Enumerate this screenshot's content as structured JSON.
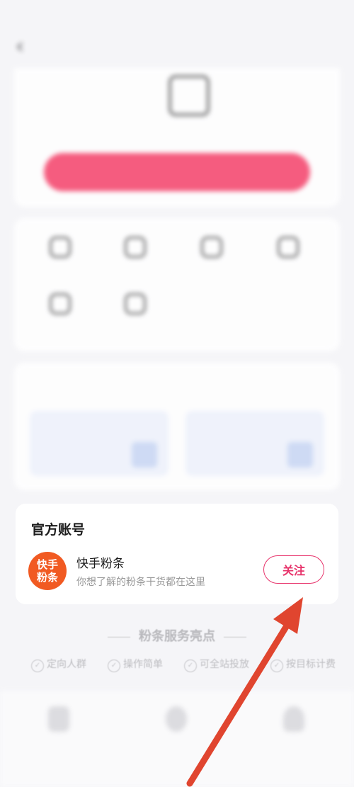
{
  "official": {
    "title": "官方账号",
    "account": {
      "avatar_text_line1": "快手",
      "avatar_text_line2": "粉条",
      "name": "快手粉条",
      "description": "你想了解的粉条干货都在这里",
      "follow_label": "关注"
    }
  },
  "highlights": {
    "title": "粉条服务亮点",
    "features": [
      "定向人群",
      "操作简单",
      "可全站投放",
      "按目标计费"
    ]
  },
  "colors": {
    "accent": "#e7326a",
    "hero_button": "#f6426a",
    "avatar": "#f15a22",
    "arrow": "#e0452f"
  }
}
